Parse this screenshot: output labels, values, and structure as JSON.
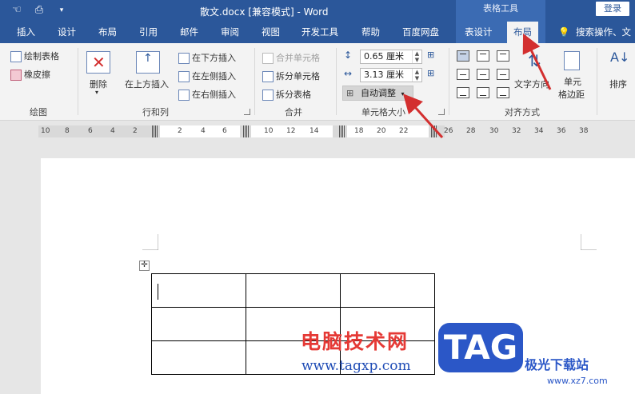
{
  "titlebar": {
    "title": "散文.docx [兼容模式]  -  Word",
    "contextual_group": "表格工具",
    "login": "登录"
  },
  "tabs": [
    "插入",
    "设计",
    "布局",
    "引用",
    "邮件",
    "审阅",
    "视图",
    "开发工具",
    "帮助",
    "百度网盘"
  ],
  "context_tabs": {
    "design": "表设计",
    "layout": "布局"
  },
  "search": "搜索操作、文",
  "ribbon": {
    "draw": {
      "draw_table": "绘制表格",
      "eraser": "橡皮擦",
      "label": "绘图"
    },
    "rows_cols": {
      "delete": "删除",
      "insert_above": "在上方插入",
      "insert_below": "在下方插入",
      "insert_left": "在左侧插入",
      "insert_right": "在右侧插入",
      "label": "行和列"
    },
    "merge": {
      "merge_cells": "合并单元格",
      "split_cells": "拆分单元格",
      "split_table": "拆分表格",
      "label": "合并"
    },
    "cell_size": {
      "height": "0.65 厘米",
      "width": "3.13 厘米",
      "autofit": "自动调整",
      "label": "单元格大小"
    },
    "alignment": {
      "text_direction": "文字方向",
      "cell_margins_1": "单元",
      "cell_margins_2": "格边距",
      "label": "对齐方式"
    },
    "sort": "排序"
  },
  "ruler": [
    "10",
    "8",
    "6",
    "4",
    "2",
    "2",
    "4",
    "6",
    "10",
    "12",
    "14",
    "18",
    "20",
    "22",
    "26",
    "28",
    "30",
    "32",
    "34",
    "36",
    "38"
  ],
  "watermark": {
    "cn": "电脑技术网",
    "url": "www.tagxp.com",
    "tag": "TAG",
    "site": "极光下载站",
    "site_url": "www.xz7.com"
  },
  "colors": {
    "word_blue": "#2b579a",
    "arrow_red": "#d32f2f"
  }
}
